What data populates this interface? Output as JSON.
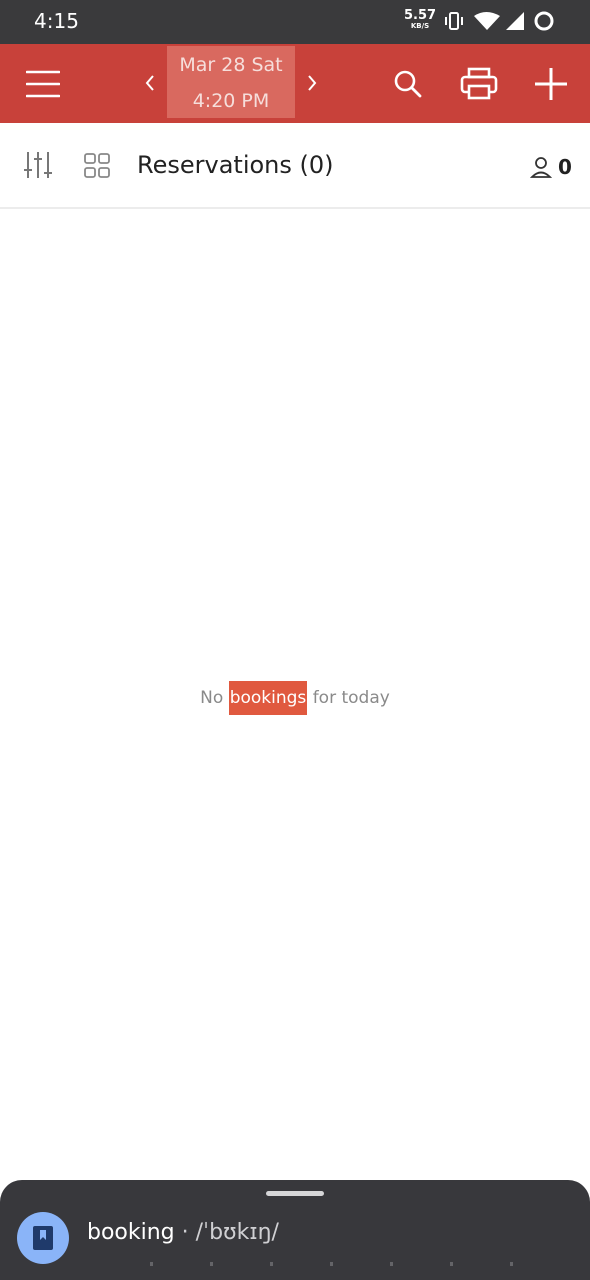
{
  "status_bar": {
    "time": "4:15",
    "speed_value": "5.57",
    "speed_unit": "KB/S"
  },
  "app_bar": {
    "date": "Mar 28 Sat",
    "time": "4:20 PM",
    "icons": [
      "menu-icon",
      "chevron-left-icon",
      "chevron-right-icon",
      "search-icon",
      "printer-icon",
      "plus-icon"
    ]
  },
  "toolbar": {
    "title": "Reservations (0)",
    "guest_count": "0",
    "icons": [
      "filter-sliders-icon",
      "grid-icon",
      "person-icon"
    ]
  },
  "empty_state": {
    "prefix": "No ",
    "highlight": "bookings",
    "suffix": " for today"
  },
  "dictionary": {
    "word": "booking",
    "pronunciation": " · /ˈbʊkɪŋ/",
    "icon": "bookmark-icon"
  },
  "colors": {
    "app_bar": "#c8413a",
    "highlight": "#e0593f",
    "sheet": "#38383c",
    "accent_avatar": "#8ab4f8"
  }
}
